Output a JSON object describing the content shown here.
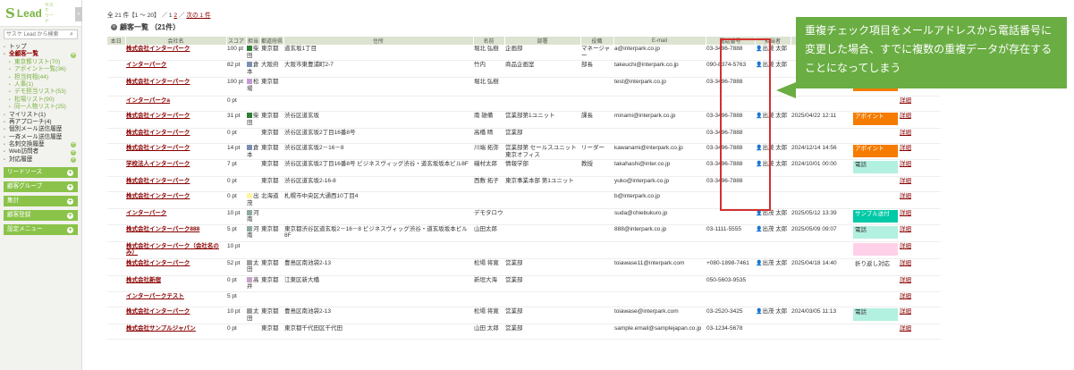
{
  "app": {
    "logo_mark": "S",
    "logo_word": "Lead",
    "logo_sub": "サスケ リード",
    "collapse": "«"
  },
  "search": {
    "placeholder": "サスケ Lead から検索"
  },
  "nav": [
    {
      "label": "トップ",
      "type": "top"
    },
    {
      "label": "全顧客一覧",
      "type": "bold"
    },
    {
      "label": "東京都リスト(70)",
      "type": "sub"
    },
    {
      "label": "アポイント一覧(36)",
      "type": "sub"
    },
    {
      "label": "担当何相(44)",
      "type": "sub"
    },
    {
      "label": "人事(1)",
      "type": "sub"
    },
    {
      "label": "デモ担当リスト(53)",
      "type": "sub"
    },
    {
      "label": "松場リスト(90)",
      "type": "sub"
    },
    {
      "label": "同一人物リスト(25)",
      "type": "sub"
    },
    {
      "label": "マイリスト(1)",
      "type": "top"
    },
    {
      "label": "再アプローチ(4)",
      "type": "top"
    },
    {
      "label": "個別メール送信履歴",
      "type": "top"
    },
    {
      "label": "一斉メール送信履歴",
      "type": "top"
    },
    {
      "label": "名刺交換履歴",
      "type": "plus"
    },
    {
      "label": "Web訪問者",
      "type": "plus"
    },
    {
      "label": "対応履歴",
      "type": "plus"
    }
  ],
  "sections": [
    "リードソース",
    "顧客グループ",
    "集計",
    "顧客登録",
    "設定メニュー"
  ],
  "pager": {
    "text": "全 21 件【1 〜 20】 ／ 1",
    "page2": "2",
    "next": "次の 1 件"
  },
  "title": {
    "icon": "list-icon",
    "label": "顧客一覧 （21件）"
  },
  "columns": [
    "本日",
    "会社名",
    "スコア",
    "担当",
    "都道府県",
    "住所",
    "名前",
    "部署",
    "役職",
    "E-mail",
    "電話番号",
    "担当者",
    "最終対応日",
    "ステータス",
    ""
  ],
  "rows": [
    {
      "company": "株式会社インターパーク",
      "score": "100 pt",
      "rep": "柴田",
      "repColor": "#2e7d32",
      "pref": "東京都",
      "addr": "道玄坂1丁目",
      "name": "堀北 弘樹",
      "dept": "企画部",
      "title": "マネージャー",
      "email": "a@interpark.co.jp",
      "phone": "03-3496-7888",
      "staff": "出茂 太郎",
      "date": "",
      "status": "",
      "statusColor": "",
      "detail": "詳細"
    },
    {
      "company": "インターパーク",
      "score": "82 pt",
      "rep": "倉本",
      "repColor": "#7b8fb0",
      "pref": "大阪府",
      "addr": "大阪市東豊浦町2-7",
      "name": "竹内",
      "dept": "商品企画室",
      "title": "部長",
      "email": "takeuchi@interpark.co.jp",
      "phone": "090-8374-5763",
      "staff": "出茂 太郎",
      "date": "",
      "status": "",
      "statusColor": "",
      "detail": "詳細"
    },
    {
      "company": "株式会社インターパーク",
      "score": "100 pt",
      "rep": "松場",
      "repColor": "#c39bd3",
      "pref": "東京都",
      "addr": "",
      "name": "堀北 弘樹",
      "dept": "",
      "title": "",
      "email": "test@interpark.co.jp",
      "phone": "03-3496-7888",
      "staff": "",
      "date": "",
      "status": "",
      "statusColor": "#f57c00",
      "detail": "詳細"
    },
    {
      "company": "インターパークa",
      "score": "0 pt",
      "rep": "",
      "repColor": "",
      "pref": "",
      "addr": "",
      "name": "",
      "dept": "",
      "title": "",
      "email": "",
      "phone": "",
      "staff": "",
      "date": "",
      "status": "",
      "statusColor": "",
      "detail": "詳細"
    },
    {
      "company": "株式会社インターパーク",
      "score": "31 pt",
      "rep": "柴田",
      "repColor": "#2e7d32",
      "pref": "東京都",
      "addr": "渋谷区道玄坂",
      "name": "南 雄備",
      "dept": "営業部第1ユニット",
      "title": "課長",
      "email": "minami@interpark.co.jp",
      "phone": "03-3496-7888",
      "staff": "出茂 太郎",
      "date": "2025/04/22 12:11",
      "status": "アポイント",
      "statusColor": "#f57c00",
      "detail": "詳細"
    },
    {
      "company": "株式会社インターパーク",
      "score": "0 pt",
      "rep": "",
      "repColor": "",
      "pref": "東京都",
      "addr": "渋谷区道玄坂2丁目16番8号",
      "name": "高橋 晴",
      "dept": "営業部",
      "title": "",
      "email": "",
      "phone": "03-3496-7888",
      "staff": "",
      "date": "",
      "status": "",
      "statusColor": "",
      "detail": "詳細"
    },
    {
      "company": "株式会社インターパーク",
      "score": "14 pt",
      "rep": "倉本",
      "repColor": "#7b8fb0",
      "pref": "東京都",
      "addr": "渋谷区道玄坂2－16－8",
      "name": "川端 拓弥",
      "dept": "営業部第 セールスユニット 東京オフィス",
      "title": "リーダー",
      "email": "kawanami@interpark.co.jp",
      "phone": "03-3496-7888",
      "staff": "出茂 太郎",
      "date": "2024/12/14 14:56",
      "status": "アポイント",
      "statusColor": "#f57c00",
      "detail": "詳細"
    },
    {
      "company": "学校法人インターパーク",
      "score": "7 pt",
      "rep": "",
      "repColor": "",
      "pref": "東京都",
      "addr": "渋谷区道玄坂2丁目16番8号 ビジネスヴィッグ渋谷・道玄坂坂本ビル8F",
      "name": "磯村太郎",
      "dept": "情報学部",
      "title": "教授",
      "email": "takahashi@inter.co.jp",
      "phone": "03-3496-7888",
      "staff": "出茂 太郎",
      "date": "2024/10/01 00:00",
      "status": "電話",
      "statusColor": "#b2f0e0",
      "detail": "詳細"
    },
    {
      "company": "株式会社インターパーク",
      "score": "0 pt",
      "rep": "",
      "repColor": "",
      "pref": "東京都",
      "addr": "渋谷区道玄坂2-16-8",
      "name": "西敷 拓子",
      "dept": "東京事業本部 第1ユニット",
      "title": "",
      "email": "yuko@interpark.co.jp",
      "phone": "03-3496-7888",
      "staff": "",
      "date": "",
      "status": "",
      "statusColor": "",
      "detail": "詳細"
    },
    {
      "company": "株式会社インターパーク",
      "score": "0 pt",
      "rep": "出茂",
      "repColor": "#fff59d",
      "pref": "北海道",
      "addr": "札幌市中央区大通西10丁目4",
      "name": "",
      "dept": "",
      "title": "",
      "email": "b@interpark.co.jp",
      "phone": "",
      "staff": "",
      "date": "",
      "status": "",
      "statusColor": "",
      "detail": "詳細"
    },
    {
      "company": "インターパーク",
      "score": "10 pt",
      "rep": "河南",
      "repColor": "#8fa8a0",
      "pref": "",
      "addr": "",
      "name": "デモタロウ",
      "dept": "",
      "title": "",
      "email": "suda@chiebukuro.jp",
      "phone": "",
      "staff": "出茂 太郎",
      "date": "2025/05/12 13:39",
      "status": "サンプル送付",
      "statusColor": "#00c9a7",
      "detail": "詳細"
    },
    {
      "company": "株式会社インターパーク888",
      "score": "5 pt",
      "rep": "河南",
      "repColor": "#8fa8a0",
      "pref": "東京都",
      "addr": "東京都渋谷区道玄坂2－16－8 ビジネスヴィッグ渋谷・道玄坂坂本ビル8F",
      "name": "山田太郎",
      "dept": "",
      "title": "",
      "email": "888@interpark.co.jp",
      "phone": "03-1111-5555",
      "staff": "出茂 太郎",
      "date": "2025/05/09 09:07",
      "status": "電話",
      "statusColor": "#b2f0e0",
      "detail": "詳細"
    },
    {
      "company": "株式会社インターパーク（会社名のみ）",
      "score": "10 pt",
      "rep": "",
      "repColor": "",
      "pref": "",
      "addr": "",
      "name": "",
      "dept": "",
      "title": "",
      "email": "",
      "phone": "",
      "staff": "",
      "date": "",
      "status": "",
      "statusColor": "#ffd1e8",
      "detail": "詳細"
    },
    {
      "company": "株式会社インターパーク",
      "score": "52 pt",
      "rep": "太田",
      "repColor": "#9e9e9e",
      "pref": "東京都",
      "addr": "豊島区南池袋2-13",
      "name": "松場 将寛",
      "dept": "営業部",
      "title": "",
      "email": "toiawase11@interpark.com",
      "phone": "+080-1898-7461",
      "staff": "出茂 太郎",
      "date": "2025/04/18 14:40",
      "status": "折り返し対応",
      "statusColor": "",
      "detail": "詳細"
    },
    {
      "company": "株式会社新宿",
      "score": "0 pt",
      "rep": "高井",
      "repColor": "#c8a2c8",
      "pref": "東京都",
      "addr": "江東区新大橋",
      "name": "新垣大海",
      "dept": "営業部",
      "title": "",
      "email": "",
      "phone": "050-5603-9535",
      "staff": "",
      "date": "",
      "status": "",
      "statusColor": "",
      "detail": "詳細"
    },
    {
      "company": "インターパークテスト",
      "score": "5 pt",
      "rep": "",
      "repColor": "",
      "pref": "",
      "addr": "",
      "name": "",
      "dept": "",
      "title": "",
      "email": "",
      "phone": "",
      "staff": "",
      "date": "",
      "status": "",
      "statusColor": "",
      "detail": "詳細"
    },
    {
      "company": "株式会社インターパーク",
      "score": "10 pt",
      "rep": "太田",
      "repColor": "#9e9e9e",
      "pref": "東京都",
      "addr": "豊島区南池袋2-13",
      "name": "松場 将寛",
      "dept": "営業部",
      "title": "",
      "email": "toiawase@interpark.com",
      "phone": "03-2520-3425",
      "staff": "出茂 太郎",
      "date": "2024/03/05 11:13",
      "status": "電話",
      "statusColor": "#b2f0e0",
      "detail": "詳細"
    },
    {
      "company": "株式会社サンプルジャパン",
      "score": "0 pt",
      "rep": "",
      "repColor": "",
      "pref": "東京都",
      "addr": "東京都千代田区千代田",
      "name": "山田 太郎",
      "dept": "営業部",
      "title": "",
      "email": "sample.email@samplejapan.co.jp",
      "phone": "03-1234-5678",
      "staff": "",
      "date": "",
      "status": "",
      "statusColor": "",
      "detail": "詳細"
    }
  ],
  "callout": {
    "text": "重複チェック項目をメールアドレスから電話番号に変更した場合、すでに複数の重複データが存在することになってしまう",
    "color": "#6aad43"
  },
  "highlight_color": "#d32f2f"
}
